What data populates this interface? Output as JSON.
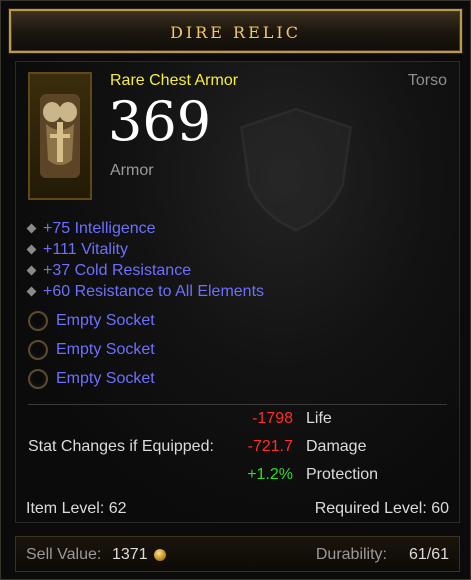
{
  "item": {
    "name": "DIRE RELIC",
    "subtype": "Rare Chest Armor",
    "slot": "Torso",
    "armor_value": "369",
    "armor_label": "Armor",
    "image_icon": "chest-armor-icon",
    "affixes": [
      "+75 Intelligence",
      "+111 Vitality",
      "+37 Cold Resistance",
      "+60 Resistance to All Elements"
    ],
    "sockets": [
      "Empty Socket",
      "Empty Socket",
      "Empty Socket"
    ]
  },
  "stat_changes": {
    "label": "Stat Changes if Equipped:",
    "rows": [
      {
        "value": "-1798",
        "label": "Life",
        "color": "#ff2d2d"
      },
      {
        "value": "-721.7",
        "label": "Damage",
        "color": "#ff2d2d"
      },
      {
        "value": "+1.2%",
        "label": "Protection",
        "color": "#2ddc2d"
      }
    ]
  },
  "levels": {
    "item_level": "Item Level: 62",
    "required_level": "Required Level: 60"
  },
  "footer": {
    "sell_label": "Sell Value:",
    "sell_value": "1371",
    "durability_label": "Durability:",
    "durability_value": "61/61"
  },
  "colors": {
    "title": "#f2c86a",
    "rare": "#f6ed3c",
    "magic": "#6f6fff",
    "loss": "#ff2d2d",
    "gain": "#2ddc2d"
  }
}
